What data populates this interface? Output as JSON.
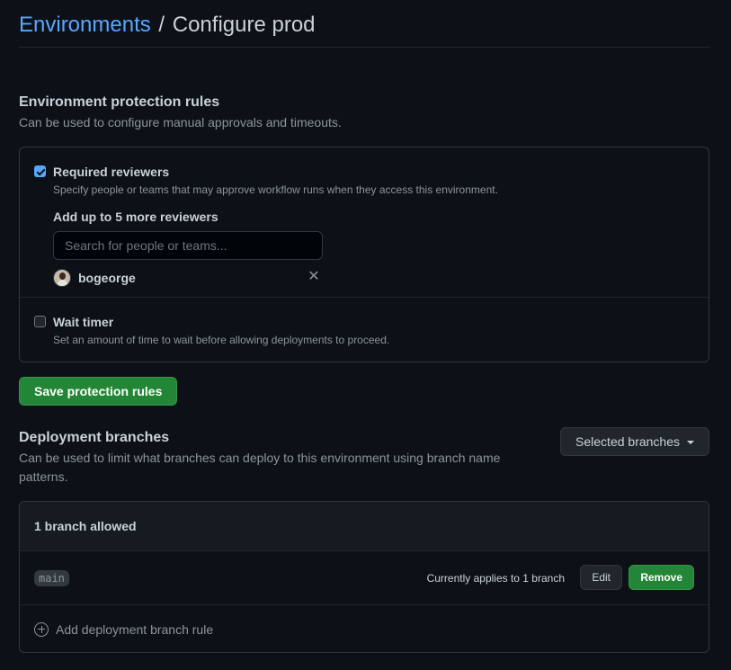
{
  "breadcrumb": {
    "parent": "Environments",
    "separator": "/",
    "current": "Configure prod"
  },
  "protection": {
    "title": "Environment protection rules",
    "description": "Can be used to configure manual approvals and timeouts.",
    "required_reviewers": {
      "checked": true,
      "title": "Required reviewers",
      "description": "Specify people or teams that may approve workflow runs when they access this environment.",
      "add_label": "Add up to 5 more reviewers",
      "search_placeholder": "Search for people or teams...",
      "reviewers": [
        {
          "username": "bogeorge"
        }
      ]
    },
    "wait_timer": {
      "checked": false,
      "title": "Wait timer",
      "description": "Set an amount of time to wait before allowing deployments to proceed."
    },
    "save_label": "Save protection rules"
  },
  "deployment": {
    "title": "Deployment branches",
    "description": "Can be used to limit what branches can deploy to this environment using branch name patterns.",
    "selector_label": "Selected branches",
    "header": "1 branch allowed",
    "rules": [
      {
        "pattern": "main",
        "applies": "Currently applies to 1 branch",
        "edit_label": "Edit",
        "remove_label": "Remove"
      }
    ],
    "add_rule_label": "Add deployment branch rule"
  },
  "icons": {
    "checkbox_checked": "checkbox-checked-icon",
    "checkbox_unchecked": "checkbox-unchecked-icon",
    "close": "close-icon",
    "caret": "caret-down-icon",
    "add": "plus-circle-icon"
  },
  "colors": {
    "background": "#0d1117",
    "link": "#58a6ff",
    "primary_button": "#238636",
    "border": "#30363d"
  }
}
